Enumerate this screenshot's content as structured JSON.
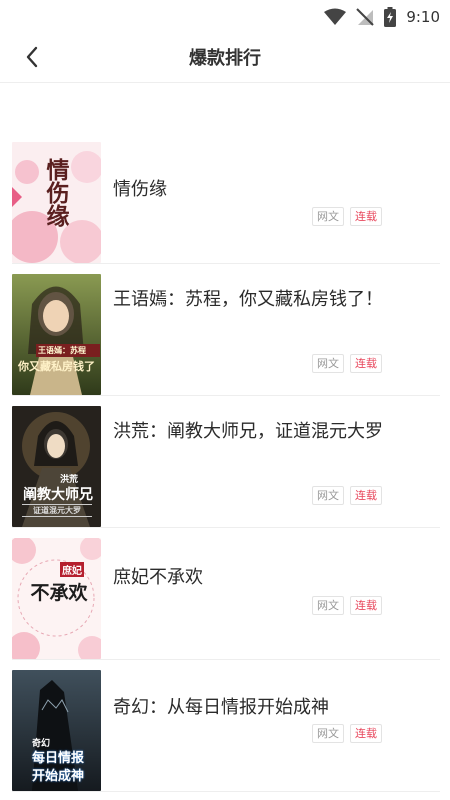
{
  "status_bar": {
    "time": "9:10"
  },
  "header": {
    "title": "爆款排行"
  },
  "books": [
    {
      "title": "情伤缘",
      "tags": [
        "网文",
        "连载"
      ],
      "cover_text": [
        "情伤缘"
      ]
    },
    {
      "title": "王语嫣：苏程，你又藏私房钱了！",
      "tags": [
        "网文",
        "连载"
      ],
      "cover_text": [
        "王语嫣：苏程",
        "你又藏私房钱了"
      ]
    },
    {
      "title": "洪荒：阐教大师兄，证道混元大罗",
      "tags": [
        "网文",
        "连载"
      ],
      "cover_text": [
        "洪荒",
        "阐教大师兄",
        "证道混元大罗"
      ]
    },
    {
      "title": "庶妃不承欢",
      "tags": [
        "网文",
        "连载"
      ],
      "cover_text": [
        "庶妃",
        "不承欢"
      ]
    },
    {
      "title": "奇幻：从每日情报开始成神",
      "tags": [
        "网文",
        "连载"
      ],
      "cover_text": [
        "奇幻",
        "每日情报",
        "开始成神"
      ]
    }
  ]
}
